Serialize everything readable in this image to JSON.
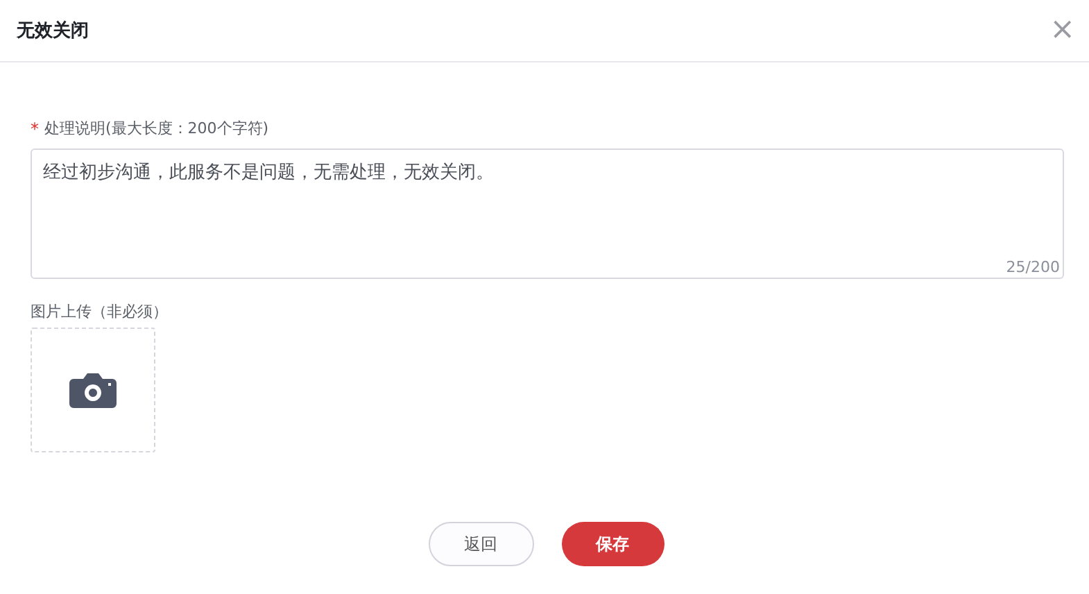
{
  "dialog": {
    "title": "无效关闭",
    "close_icon": "×"
  },
  "description_field": {
    "required_mark": "*",
    "label": "处理说明(最大长度：200个字符)",
    "value": "经过初步沟通，此服务不是问题，无需处理，无效关闭。",
    "counter": "25/200"
  },
  "image_upload": {
    "label": "图片上传（非必须）"
  },
  "buttons": [
    {
      "label": "返回",
      "kind": "secondary"
    },
    {
      "label": "保存",
      "kind": "primary"
    }
  ]
}
